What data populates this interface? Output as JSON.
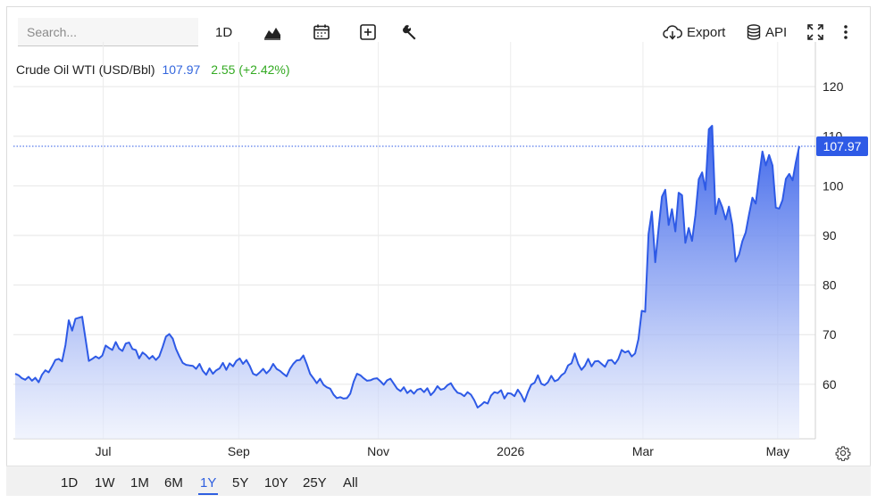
{
  "toolbar": {
    "search_placeholder": "Search...",
    "interval_label": "1D",
    "export_label": "Export",
    "api_label": "API"
  },
  "legend": {
    "name": "Crude Oil WTI (USD/Bbl)",
    "price": "107.97",
    "change": "2.55 (+2.42%)"
  },
  "price_tag": "107.97",
  "ranges": [
    "1D",
    "1W",
    "1M",
    "6M",
    "1Y",
    "5Y",
    "10Y",
    "25Y",
    "All"
  ],
  "active_range": "1Y",
  "colors": {
    "line": "#2e5ae6",
    "fill_top": "#3a63ea",
    "positive": "#33aa22",
    "tag": "#2e5ae6"
  },
  "chart_data": {
    "type": "area",
    "title": "Crude Oil WTI (USD/Bbl)",
    "ylim": [
      49,
      129
    ],
    "yticks": [
      60,
      70,
      80,
      90,
      100,
      110,
      120
    ],
    "xlabels": [
      {
        "label": "Jul",
        "x": 0.112
      },
      {
        "label": "Sep",
        "x": 0.281
      },
      {
        "label": "Nov",
        "x": 0.455
      },
      {
        "label": "2026",
        "x": 0.62
      },
      {
        "label": "Mar",
        "x": 0.785
      },
      {
        "label": "May",
        "x": 0.953
      }
    ],
    "grid": true,
    "last_value": 107.97,
    "values": [
      62.1,
      61.8,
      61.2,
      60.9,
      61.5,
      60.7,
      61.3,
      60.4,
      61.9,
      62.8,
      62.4,
      63.6,
      64.9,
      65.1,
      64.6,
      67.9,
      72.9,
      70.8,
      73.2,
      73.4,
      73.6,
      69.1,
      64.7,
      65.1,
      65.6,
      65.2,
      65.8,
      67.8,
      67.3,
      66.9,
      68.5,
      67.2,
      66.7,
      68.2,
      68.4,
      67.1,
      66.9,
      65.2,
      66.4,
      65.9,
      65.1,
      65.7,
      64.9,
      65.6,
      67.5,
      69.6,
      70.1,
      69.2,
      67.1,
      65.6,
      64.3,
      63.9,
      63.8,
      63.7,
      63.1,
      64.1,
      62.7,
      61.9,
      63.2,
      62.1,
      62.8,
      63.2,
      64.3,
      62.9,
      64.2,
      63.6,
      64.7,
      65.2,
      64.1,
      64.9,
      63.7,
      62.1,
      61.8,
      62.4,
      63.1,
      62.2,
      62.9,
      64.1,
      63.1,
      62.7,
      62.1,
      61.6,
      63.1,
      64.1,
      64.8,
      64.9,
      65.8,
      64.1,
      62.1,
      61.2,
      60.2,
      61.1,
      59.9,
      59.4,
      59.1,
      57.9,
      57.2,
      57.4,
      57.1,
      57.2,
      58.1,
      60.5,
      62.1,
      61.8,
      61.2,
      60.7,
      60.8,
      61.1,
      61.2,
      60.6,
      59.9,
      60.8,
      61.1,
      60.1,
      59.1,
      58.6,
      59.4,
      58.2,
      58.8,
      58.1,
      58.9,
      59.1,
      58.4,
      59.2,
      57.8,
      58.5,
      59.6,
      58.9,
      59.1,
      59.8,
      60.2,
      59.1,
      58.3,
      58.1,
      57.6,
      58.4,
      57.9,
      56.8,
      55.3,
      55.8,
      56.4,
      56.1,
      57.7,
      58.4,
      58.2,
      58.8,
      57.1,
      58.2,
      58.1,
      57.6,
      58.9,
      57.9,
      56.5,
      58.4,
      59.9,
      60.3,
      61.8,
      60.1,
      59.8,
      60.4,
      61.7,
      60.6,
      60.9,
      61.8,
      62.3,
      63.8,
      64.2,
      66.2,
      64.1,
      62.9,
      63.7,
      65.1,
      63.6,
      64.6,
      64.7,
      64.1,
      63.5,
      64.8,
      64.9,
      64.1,
      65.1,
      66.9,
      66.4,
      66.7,
      65.6,
      66.2,
      69.1,
      74.8,
      74.6,
      90.3,
      94.8,
      84.6,
      91.3,
      97.8,
      99.2,
      92.1,
      95.3,
      90.8,
      98.6,
      98.1,
      88.5,
      91.5,
      88.9,
      94.1,
      101.3,
      102.7,
      99.2,
      111.4,
      112.1,
      94.3,
      97.4,
      95.7,
      93.2,
      95.8,
      92.1,
      84.7,
      86.1,
      88.8,
      90.6,
      94.2,
      97.6,
      96.4,
      101.9,
      106.9,
      104.1,
      106.2,
      104.1,
      95.6,
      95.4,
      97.1,
      101.4,
      102.4,
      101.1,
      104.8,
      107.97
    ]
  }
}
